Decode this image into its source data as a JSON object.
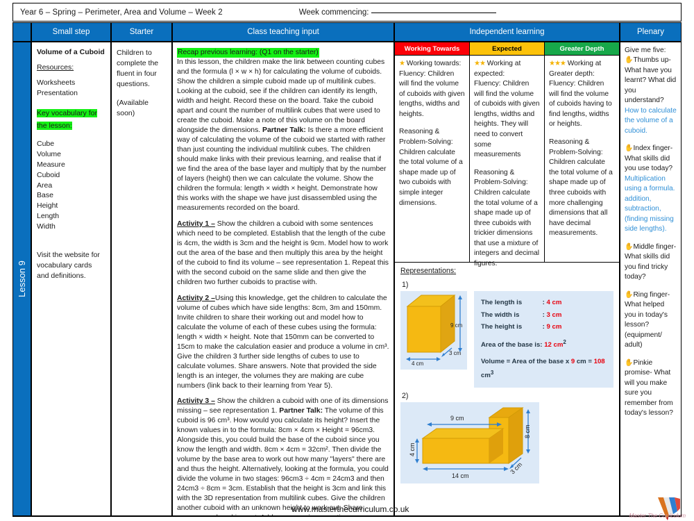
{
  "header": {
    "title": "Year 6 – Spring – Perimeter, Area and Volume – Week 2",
    "week_commencing_label": "Week commencing:",
    "columns": {
      "small_step": "Small step",
      "starter": "Starter",
      "class_teaching_input": "Class teaching input",
      "independent_learning": "Independent learning",
      "plenary": "Plenary"
    }
  },
  "spine": {
    "lesson_label": "Lesson 9"
  },
  "small_step": {
    "title": "Volume of a Cuboid",
    "resources_heading": "Resources:",
    "resources": [
      "Worksheets",
      "Presentation"
    ],
    "vocab_heading": "Key vocabulary for the lesson:",
    "vocabulary": [
      "Cube",
      "Volume",
      "Measure",
      "Cuboid",
      "Area",
      "Base",
      "Height",
      "Length",
      "Width"
    ],
    "footer": "Visit the website for vocabulary cards and definitions."
  },
  "starter": {
    "paragraph": "Children to complete the fluent in four questions.",
    "note": "(Available soon)"
  },
  "class_teaching_input": {
    "recap_highlight": "Recap previous learning: (Q1 on the starter)",
    "intro": "In this lesson, the children make the link between counting cubes and the formula (l × w × h) for calculating the volume of cuboids. Show the children a simple cuboid made up of multilink cubes. Looking at the cuboid, see if the children can identify its length, width and height.  Record these on the board. Take the cuboid apart and count the number of multilink cubes that were used to create the cuboid. Make a note of this volume on the board alongside the dimensions. ",
    "intro_bold": "Partner Talk:",
    "intro_cont": " Is there a more efficient way of calculating the volume of the cuboid we started with rather than just counting the individual multilink cubes. The children should make links with their previous learning, and realise that if we find the area of the base layer and multiply that by the number of layers (height) then we can calculate the volume. Show the children the formula: length × width × height. Demonstrate how this works with the shape we have just disassembled using the measurements recorded on the board.",
    "activity1_label": "Activity 1 –",
    "activity1": " Show the children a cuboid with some sentences which need to be completed. Establish that the length of the cube is 4cm, the width is 3cm and the height is 9cm. Model how to work out the area of the base and then multiply this area by the height of the cuboid to find its volume – see representation 1. Repeat this with the second cuboid on the same slide and then give the children two further cuboids to practise with.",
    "activity2_label": "Activity 2 –",
    "activity2": "Using this knowledge, get the children to calculate the volume of cubes which have side lengths: 8cm, 3m and 150mm. Invite children to share their working out and model how to calculate the volume of each of these cubes using the formula: length × width × height. Note that 150mm can be converted to 15cm to make the calculation easier and produce a volume in cm³. Give the children 3 further side lengths of cubes to use to calculate volumes. Share answers. Note that provided the side length is an integer, the volumes they are making are cube numbers (link back to their learning from Year 5).",
    "activity3_label": "Activity 3 –",
    "activity3_a": " Show the children a cuboid with one of its dimensions missing – see representation 1. ",
    "activity3_bold": "Partner Talk:",
    "activity3_b": " The volume of this cuboid is 96 cm³. How would you calculate its height? Insert the known values in to the formula: 8cm × 4cm × Height = 96cm3. Alongside this, you could build the base of the cuboid since you know the length and width. 8cm × 4cm = 32cm². Then divide the volume by the base area to work out how many \"layers\" there are and thus the height. Alternatively, looking at the formula, you could divide the volume in two stages: 96cm3 ÷ 4cm = 24cm3 and then 24cm3 ÷ 8cm = 3cm. Establish that the height is 3cm and link this with the 3D representation from multilink cubes. Give the children another cuboid with an unknown height to work out. Share answers and working out. Address any misconceptions"
  },
  "independent_learning": {
    "working_towards": {
      "heading": "Working Towards",
      "stars": "★",
      "intro": " Working towards:",
      "fluency": "Fluency: Children will find the volume of cuboids with given lengths, widths and heights.",
      "reasoning": "Reasoning & Problem-Solving: Children calculate the total volume of a shape made up of two cuboids with simple integer dimensions."
    },
    "expected": {
      "heading": "Expected",
      "stars": "★★",
      "intro": " Working at expected:",
      "fluency": "Fluency: Children will find the volume of cuboids with given lengths, widths and heights. They will need to convert some measurements",
      "reasoning": "Reasoning & Problem-Solving: Children calculate the total volume of a shape made up of three cuboids with trickier dimensions that use a mixture of integers and decimal figures."
    },
    "greater_depth": {
      "heading": "Greater Depth",
      "stars": "★★★",
      "intro": " Working at Greater depth:",
      "fluency": "Fluency: Children will find the volume of cuboids having to find lengths, widths or heights.",
      "reasoning": "Reasoning & Problem-Solving: Children calculate the total volume of a shape made up of three cuboids with more challenging dimensions that all have decimal measurements."
    }
  },
  "representations": {
    "title": "Representations:",
    "item1_number": "1)",
    "item2_number": "2)",
    "cuboid1": {
      "width_label": "4 cm",
      "depth_label": "3 cm",
      "height_label": "9 cm"
    },
    "info": {
      "length_label": "The length is",
      "length_value": "4 cm",
      "width_label": "The width is",
      "width_value": "3 cm",
      "height_label": "The height is",
      "height_value": "9 cm",
      "base_label": "Area of the base is:",
      "base_value": "12 cm",
      "base_unit": "2",
      "volume_prefix": "Volume = Area of the base x ",
      "volume_factor": "9",
      "volume_mid": " cm = ",
      "volume_value": "108",
      "volume_unit": " cm",
      "volume_sup": "3",
      "colon": ":"
    },
    "composite": {
      "top_label": "9 cm",
      "bottom_label": "14 cm",
      "left_label": "4 cm",
      "right_label": "8 cm",
      "depth_label": "3 cm"
    }
  },
  "plenary": {
    "intro": "Give me five:",
    "items": [
      {
        "prompt": "Thumbs up- What have you learnt? What did you understand?",
        "answer": "How to calculate the volume of a cuboid."
      },
      {
        "prompt": "Index finger- What skills did you use today?",
        "answer": "Multiplication using a formula. addition, subtraction, (finding missing side lengths)."
      },
      {
        "prompt": "Middle finger- What skills did you find tricky today?",
        "answer": ""
      },
      {
        "prompt": "Ring finger- What helped you in today's lesson? (equipment/ adult)",
        "answer": ""
      },
      {
        "prompt": "Pinkie promise- What will you make sure you remember from today's lesson?",
        "answer": ""
      }
    ]
  },
  "footer": {
    "url": "www.masterthecurriculum.co.uk",
    "logo_text": "Master The Curriculum"
  }
}
